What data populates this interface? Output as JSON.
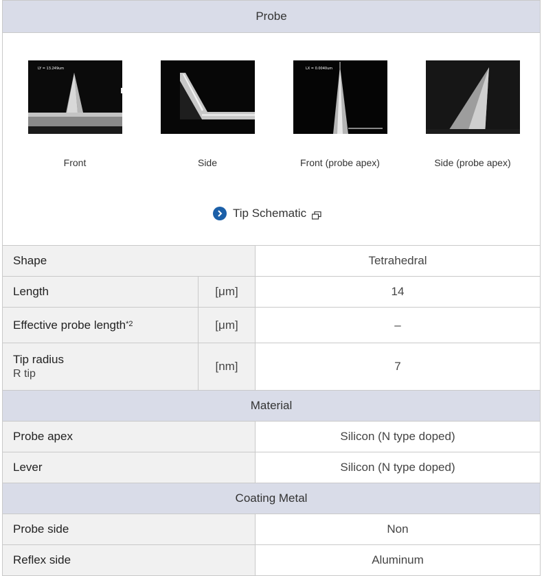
{
  "probe_section": {
    "title": "Probe"
  },
  "figures": [
    {
      "caption": "Front",
      "scale_text": "LY = 13.249um"
    },
    {
      "caption": "Side",
      "scale_text": ""
    },
    {
      "caption": "Front (probe apex)",
      "scale_text": "LX = 0.0040um"
    },
    {
      "caption": "Side (probe apex)",
      "scale_text": ""
    }
  ],
  "tip_schematic": {
    "label": "Tip Schematic"
  },
  "specs": [
    {
      "label": "Shape",
      "unit": "",
      "value": "Tetrahedral"
    },
    {
      "label": "Length",
      "unit": "[μm]",
      "value": "14"
    },
    {
      "label": "Effective probe length",
      "sup": "*2",
      "unit": "[μm]",
      "value": "–"
    },
    {
      "label": "Tip radius",
      "sublabel": "R tip",
      "unit": "[nm]",
      "value": "7"
    }
  ],
  "material_section": {
    "title": "Material"
  },
  "material": [
    {
      "label": "Probe apex",
      "value": "Silicon (N type doped)"
    },
    {
      "label": "Lever",
      "value": "Silicon (N type doped)"
    }
  ],
  "coating_section": {
    "title": "Coating Metal"
  },
  "coating": [
    {
      "label": "Probe side",
      "value": "Non"
    },
    {
      "label": "Reflex side",
      "value": "Aluminum"
    }
  ]
}
